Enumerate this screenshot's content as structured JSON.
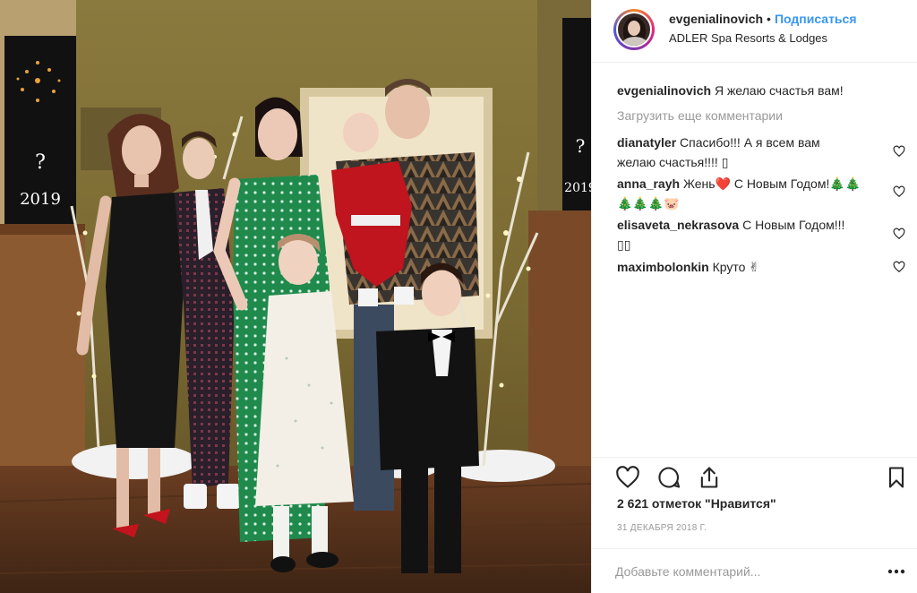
{
  "post": {
    "username": "evgenialinovich",
    "separator": "•",
    "follow_label": "Подписаться",
    "location": "ADLER Spa Resorts & Lodges"
  },
  "caption": {
    "username": "evgenialinovich",
    "text": "Я желаю счастья вам!"
  },
  "load_more_label": "Загрузить еще комментарии",
  "comments": [
    {
      "username": "dianatyler",
      "line1": "Спасибо!!! А я всем вам",
      "line2": "желаю счастья!!!! ▯"
    },
    {
      "username": "anna_rayh",
      "line1": "Жень❤️ С Новым Годом!🎄🎄",
      "line2": "🎄🎄🎄🐷"
    },
    {
      "username": "elisaveta_nekrasova",
      "line1": "С Новым Годом!!!",
      "line2": "▯▯"
    },
    {
      "username": "maximbolonkin",
      "line1": "Круто ✌",
      "line2": ""
    }
  ],
  "likes_text": "2 621 отметок \"Нравится\"",
  "date_text": "31 ДЕКАБРЯ 2018 Г.",
  "add_comment_placeholder": "Добавьте комментарий...",
  "photo_posters": [
    {
      "year": "2019",
      "mark": "?"
    },
    {
      "year": "2019",
      "mark": "?"
    }
  ],
  "icons": [
    "heart-icon",
    "comment-icon",
    "share-icon",
    "bookmark-icon",
    "more-icon"
  ],
  "colors": {
    "accent": "#3897f0",
    "text": "#262626",
    "muted": "#999999",
    "border": "#efefef"
  }
}
